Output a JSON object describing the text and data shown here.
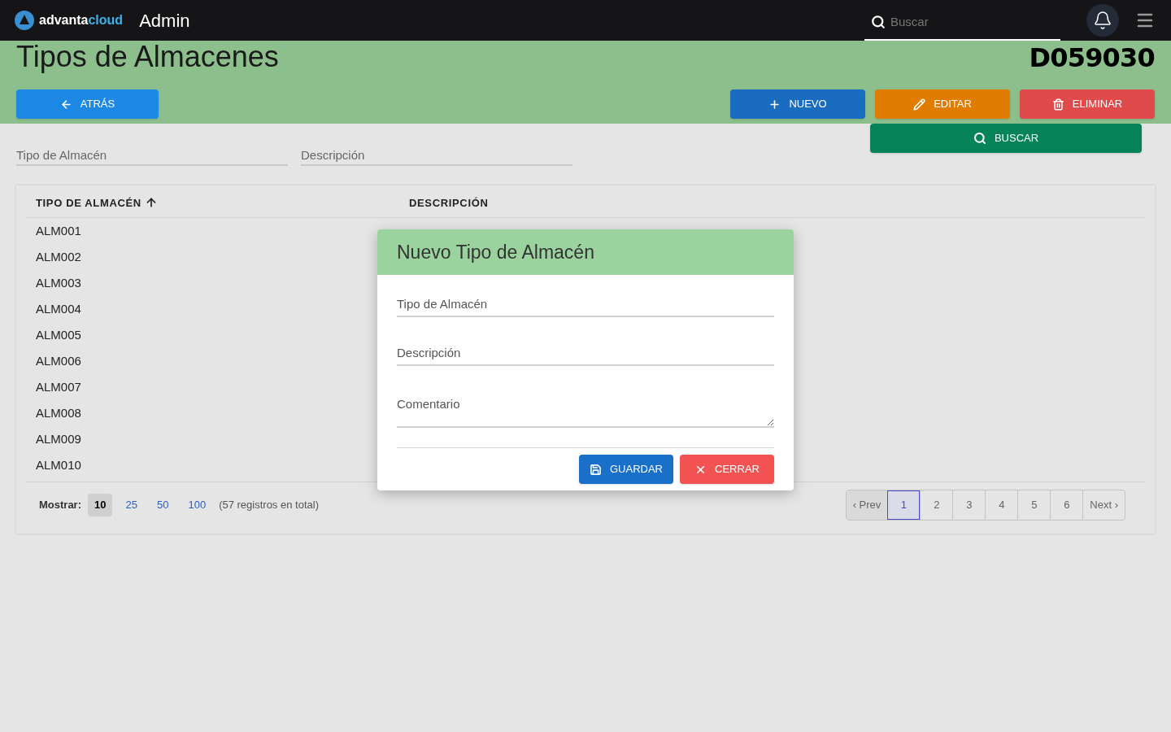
{
  "topbar": {
    "logo": {
      "word_1": "advanta",
      "word_2": "cloud"
    },
    "app_title": "Admin",
    "search": {
      "placeholder": "Buscar"
    }
  },
  "page": {
    "title": "Tipos de Almacenes",
    "code": "D059030"
  },
  "actions": [
    {
      "label": "ATRÁS",
      "kind": "back"
    },
    {
      "label": "NUEVO",
      "kind": "new"
    },
    {
      "label": "EDITAR",
      "kind": "edit"
    },
    {
      "label": "ELIMINAR",
      "kind": "delete"
    }
  ],
  "search_button": "BUSCAR",
  "filters": [
    {
      "placeholder": "Tipo de Almacén"
    },
    {
      "placeholder": "Descripción"
    }
  ],
  "table": {
    "columns": [
      {
        "label": "TIPO DE ALMACÉN",
        "sorted": true
      },
      {
        "label": "DESCRIPCIÓN",
        "sorted": false
      }
    ],
    "rows": [
      "ALM001",
      "ALM002",
      "ALM003",
      "ALM004",
      "ALM005",
      "ALM006",
      "ALM007",
      "ALM008",
      "ALM009",
      "ALM010"
    ]
  },
  "footer": {
    "show_label": "Mostrar:",
    "page_sizes": [
      {
        "label": "10",
        "selected": true
      },
      {
        "label": "25",
        "selected": false
      },
      {
        "label": "50",
        "selected": false
      },
      {
        "label": "100",
        "selected": false
      }
    ],
    "total": "(57 registros en total)"
  },
  "pagination": {
    "prev": "‹ Prev",
    "next": "Next ›",
    "pages": [
      {
        "label": "1",
        "selected": true
      },
      {
        "label": "2",
        "selected": false
      },
      {
        "label": "3",
        "selected": false
      },
      {
        "label": "4",
        "selected": false
      },
      {
        "label": "5",
        "selected": false
      },
      {
        "label": "6",
        "selected": false
      }
    ]
  },
  "dialog": {
    "title": "Nuevo Tipo de Almacén",
    "fields": [
      {
        "placeholder": "Tipo de Almacén",
        "kind": "input"
      },
      {
        "placeholder": "Descripción",
        "kind": "input"
      },
      {
        "placeholder": "Comentario",
        "kind": "textarea"
      }
    ],
    "buttons": [
      {
        "label": "GUARDAR",
        "kind": "save"
      },
      {
        "label": "CERRAR",
        "kind": "close"
      }
    ]
  }
}
